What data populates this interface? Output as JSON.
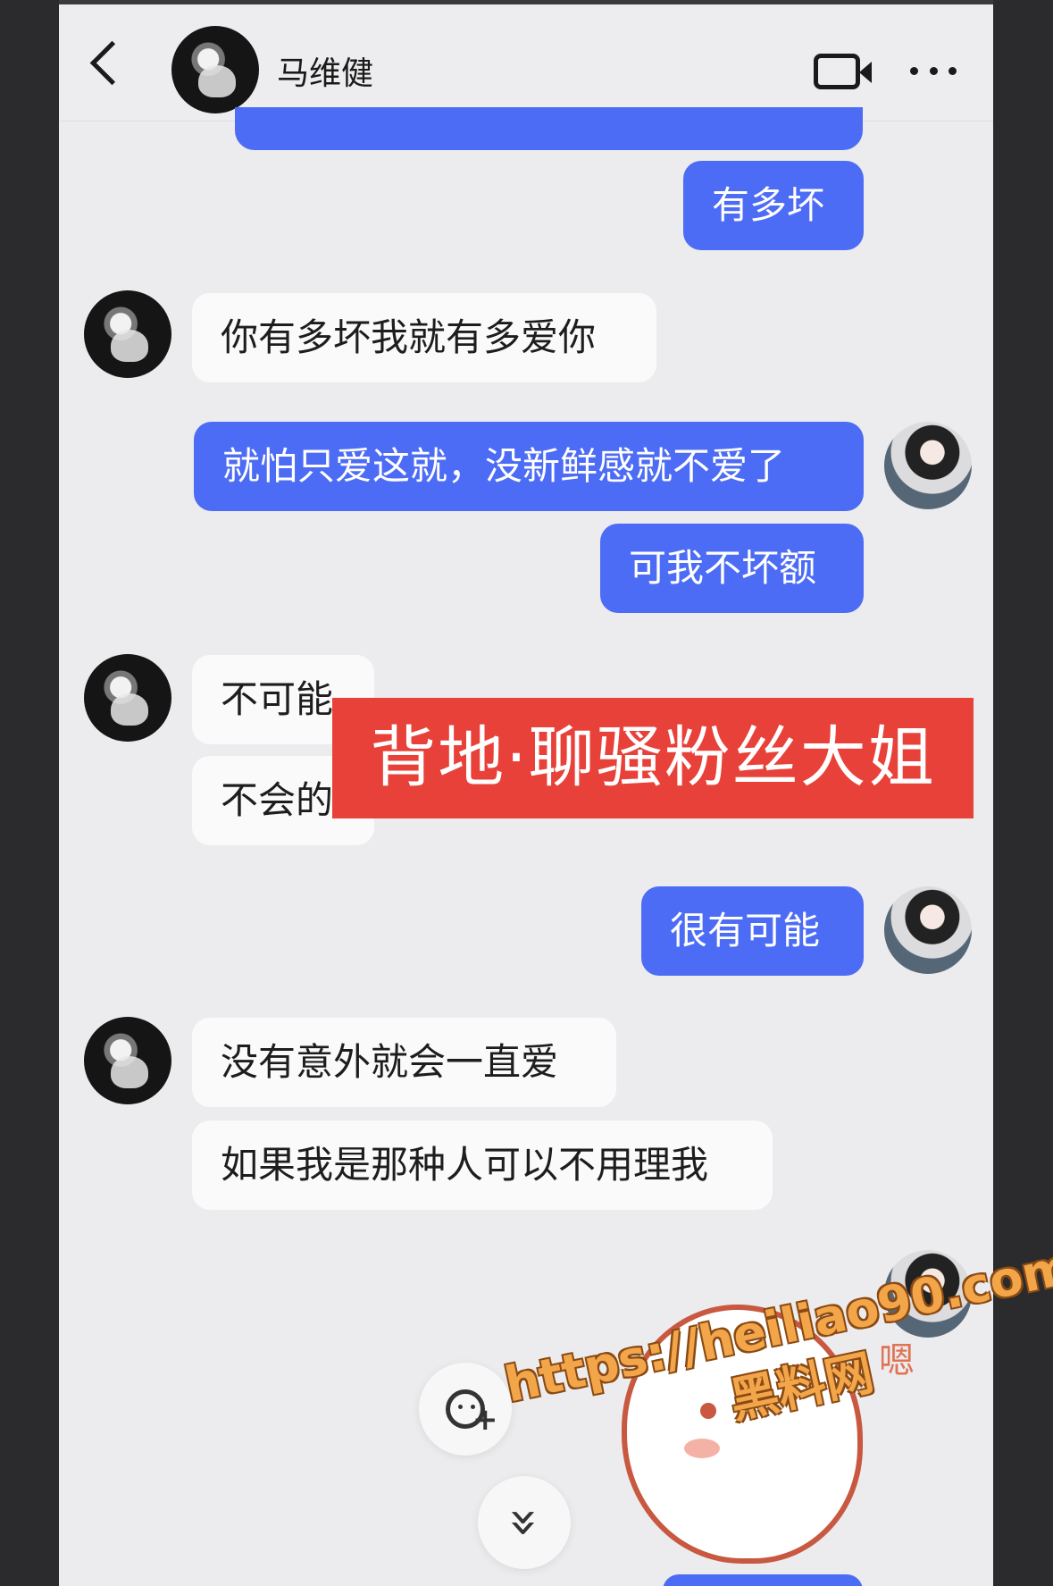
{
  "header": {
    "contact_name": "马维健",
    "back_icon": "chevron-left-icon",
    "video_icon": "video-call-icon",
    "more_icon": "more-horizontal-icon"
  },
  "messages": [
    {
      "side": "mine",
      "text": "有多坏"
    },
    {
      "side": "theirs",
      "text": "你有多坏我就有多爱你"
    },
    {
      "side": "mine",
      "text": "就怕只爱这就，没新鲜感就不爱了"
    },
    {
      "side": "mine",
      "text": "可我不坏额"
    },
    {
      "side": "theirs",
      "text": "不可能"
    },
    {
      "side": "theirs",
      "text": "不会的"
    },
    {
      "side": "mine",
      "text": "很有可能"
    },
    {
      "side": "theirs",
      "text": "没有意外就会一直爱"
    },
    {
      "side": "theirs",
      "text": "如果我是那种人可以不用理我"
    }
  ],
  "overlay_banner": "背地·聊骚粉丝大姐",
  "sticker": {
    "text": "嗯"
  },
  "floating_buttons": {
    "emoji_icon": "emoji-add-icon",
    "scroll_icon": "double-chevron-down-icon"
  },
  "watermark": {
    "url": "https://heiliao90.com",
    "site": "黑料网"
  },
  "colors": {
    "my_bubble": "#4d6cf5",
    "their_bubble": "#fafafa",
    "banner": "#e8413a",
    "background": "#ececee"
  }
}
